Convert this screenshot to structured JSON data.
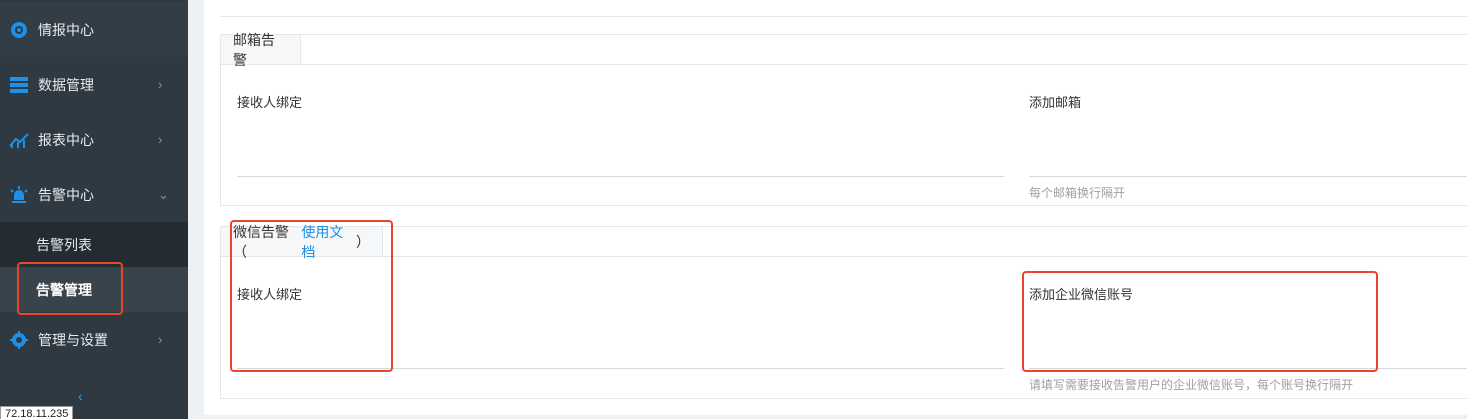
{
  "sidebar": {
    "items": [
      {
        "label": "情报中心",
        "icon": "radar-icon"
      },
      {
        "label": "数据管理",
        "icon": "database-icon",
        "chevron": "›"
      },
      {
        "label": "报表中心",
        "icon": "line-chart-icon",
        "chevron": "›"
      },
      {
        "label": "告警中心",
        "icon": "siren-icon",
        "chevron": "⌄"
      },
      {
        "label": "管理与设置",
        "icon": "gear-icon",
        "chevron": "›"
      }
    ],
    "sub_items": [
      {
        "label": "告警列表"
      },
      {
        "label": "告警管理"
      }
    ],
    "collapse_glyph": "‹",
    "ip_tooltip": "72.18.11.235"
  },
  "email_section": {
    "title": "邮箱告警",
    "receiver_label": "接收人绑定",
    "add_label": "添加邮箱",
    "hint": "每个邮箱换行隔开"
  },
  "wechat_section": {
    "title_prefix": "微信告警（",
    "doc_link": "使用文档",
    "title_suffix": "）",
    "receiver_label": "接收人绑定",
    "add_label": "添加企业微信账号",
    "hint": "请填写需要接收告警用户的企业微信账号，每个账号换行隔开"
  },
  "colors": {
    "sidebar_bg": "#2f3942",
    "accent_blue": "#1a8fe3",
    "highlight_red": "#e8452c"
  }
}
